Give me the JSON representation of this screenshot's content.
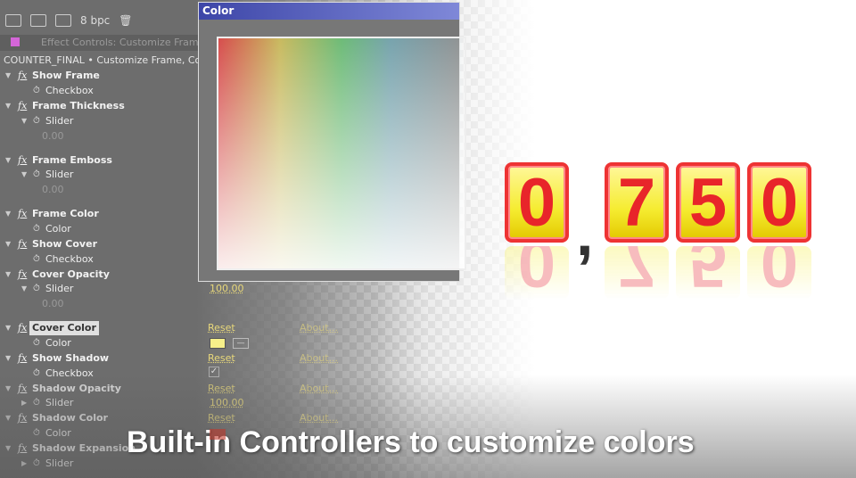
{
  "toolbar": {
    "bit_depth": "8 bpc"
  },
  "panel": {
    "tab_title": "Effect Controls: Customize Frame, Cover,",
    "comp_line": "COUNTER_FINAL • Customize Frame, Cover"
  },
  "effects": [
    {
      "name": "Show Frame",
      "param": "Checkbox"
    },
    {
      "name": "Frame Thickness",
      "param": "Slider",
      "value": "0.00"
    },
    {
      "name": "Frame Emboss",
      "param": "Slider",
      "value": "0.00"
    },
    {
      "name": "Frame Color",
      "param": "Color"
    },
    {
      "name": "Show Cover",
      "param": "Checkbox"
    },
    {
      "name": "Cover Opacity",
      "param": "Slider",
      "value": "0.00",
      "current": "100.00"
    },
    {
      "name": "Cover Color",
      "param": "Color",
      "color": "#f7f08a"
    },
    {
      "name": "Show Shadow",
      "param": "Checkbox",
      "checked": true
    },
    {
      "name": "Shadow Opacity",
      "param": "Slider",
      "current": "100.00"
    },
    {
      "name": "Shadow Color",
      "param": "Color",
      "color": "#c0392b"
    },
    {
      "name": "Shadow Expansion",
      "param": "Slider"
    }
  ],
  "links": {
    "reset": "Reset",
    "about": "About..."
  },
  "dialog": {
    "title": "Color"
  },
  "counter": {
    "digits": [
      "0",
      "7",
      "5",
      "0"
    ],
    "separator": ","
  },
  "caption": "Built-in Controllers to customize colors"
}
